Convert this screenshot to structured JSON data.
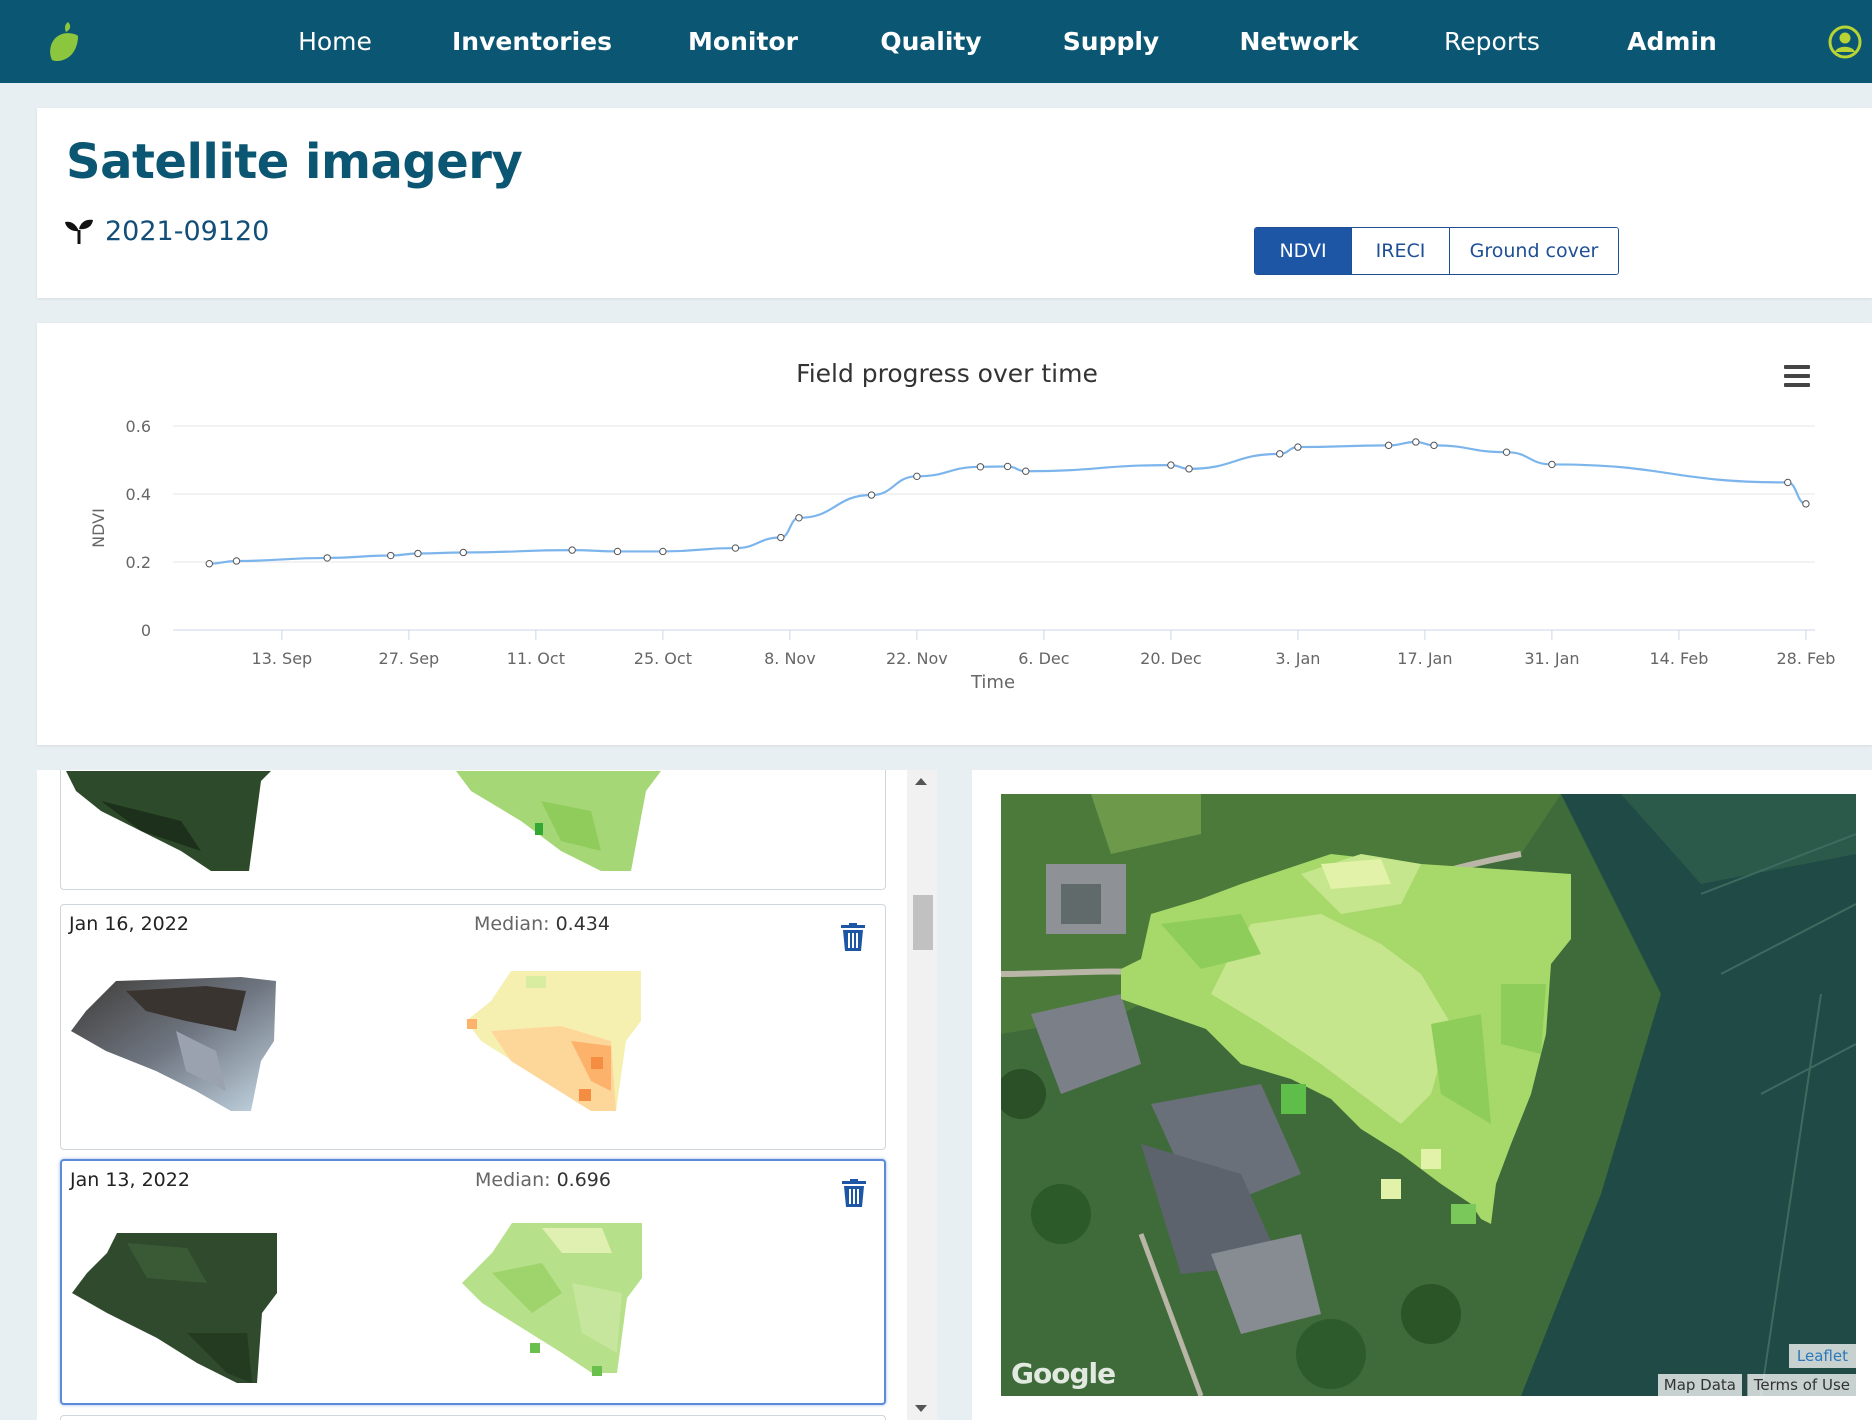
{
  "nav": {
    "items": [
      "Home",
      "Inventories",
      "Monitor",
      "Quality",
      "Supply",
      "Network",
      "Reports",
      "Admin"
    ]
  },
  "colors": {
    "brand": "#0b5672",
    "accent": "#1e56a6",
    "logo": "#8cc63f",
    "line": "#7cb5ec"
  },
  "header": {
    "title": "Satellite imagery",
    "field_id": "2021-09120",
    "toggles": [
      {
        "label": "NDVI",
        "active": true
      },
      {
        "label": "IRECI",
        "active": false
      },
      {
        "label": "Ground cover",
        "active": false
      }
    ]
  },
  "icons": {
    "logo": "leaf-logo-icon",
    "user": "user-icon",
    "sprout": "sprout-icon",
    "menu": "hamburger-menu-icon",
    "trash": "trash-icon"
  },
  "chart_data": {
    "type": "line",
    "title": "Field progress over time",
    "xlabel": "Time",
    "ylabel": "NDVI",
    "ylim": [
      0,
      0.6
    ],
    "yticks": [
      "0",
      "0.2",
      "0.4",
      "0.6"
    ],
    "x_tick_labels": [
      "13. Sep",
      "27. Sep",
      "11. Oct",
      "25. Oct",
      "8. Nov",
      "22. Nov",
      "6. Dec",
      "20. Dec",
      "3. Jan",
      "17. Jan",
      "31. Jan",
      "14. Feb",
      "28. Feb"
    ],
    "grid": true,
    "legend": "none",
    "series": [
      {
        "x": [
          "2021-09-05",
          "2021-09-08",
          "2021-09-18",
          "2021-09-25",
          "2021-09-28",
          "2021-10-03",
          "2021-10-15",
          "2021-10-20",
          "2021-10-25",
          "2021-11-02",
          "2021-11-07",
          "2021-11-09",
          "2021-11-17",
          "2021-11-22",
          "2021-11-29",
          "2021-12-02",
          "2021-12-04",
          "2021-12-20",
          "2021-12-22",
          "2022-01-01",
          "2022-01-03",
          "2022-01-13",
          "2022-01-16",
          "2022-01-18",
          "2022-01-26",
          "2022-01-31",
          "2022-02-26",
          "2022-02-28"
        ],
        "y": [
          0.195,
          0.203,
          0.212,
          0.219,
          0.225,
          0.228,
          0.235,
          0.231,
          0.231,
          0.241,
          0.272,
          0.33,
          0.397,
          0.452,
          0.48,
          0.481,
          0.467,
          0.485,
          0.474,
          0.518,
          0.538,
          0.543,
          0.553,
          0.543,
          0.523,
          0.487,
          0.434,
          0.371
        ]
      }
    ]
  },
  "images": [
    {
      "date": "",
      "median_label": "",
      "median_value": ""
    },
    {
      "date": "Jan 16, 2022",
      "median_label": "Median:",
      "median_value": "0.434"
    },
    {
      "date": "Jan 13, 2022",
      "median_label": "Median:",
      "median_value": "0.696",
      "selected": true
    }
  ],
  "map": {
    "leaflet": "Leaflet",
    "map_data": "Map Data",
    "terms": "Terms of Use",
    "google": "Google"
  }
}
